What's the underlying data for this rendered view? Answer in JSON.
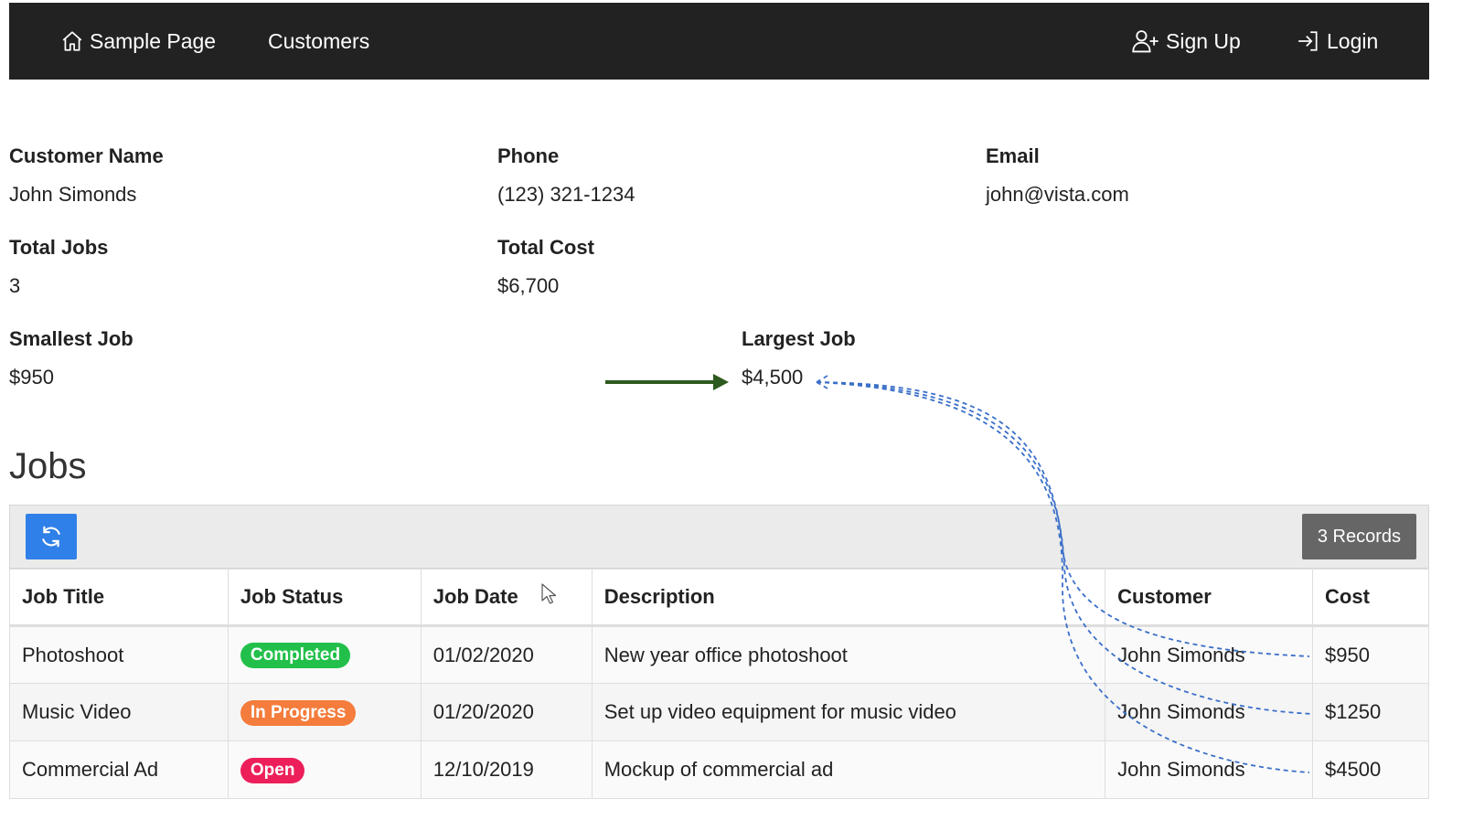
{
  "nav": {
    "brand_label": "Sample Page",
    "customers_label": "Customers",
    "signup_label": "Sign Up",
    "login_label": "Login",
    "brand_icon": "home-icon",
    "signup_icon": "user-plus-icon",
    "login_icon": "login-icon"
  },
  "customer": {
    "name_label": "Customer Name",
    "name": "John Simonds",
    "phone_label": "Phone",
    "phone": "(123) 321-1234",
    "email_label": "Email",
    "email": "john@vista.com",
    "total_jobs_label": "Total Jobs",
    "total_jobs": "3",
    "total_cost_label": "Total Cost",
    "total_cost": "$6,700",
    "smallest_job_label": "Smallest Job",
    "smallest_job": "$950",
    "largest_job_label": "Largest Job",
    "largest_job": "$4,500"
  },
  "jobs": {
    "heading": "Jobs",
    "refresh_icon": "refresh-icon",
    "records_label": "3 Records",
    "columns": [
      "Job Title",
      "Job Status",
      "Job Date",
      "Description",
      "Customer",
      "Cost"
    ],
    "rows": [
      {
        "title": "Photoshoot",
        "status": "Completed",
        "date": "01/02/2020",
        "description": "New year office photoshoot",
        "customer": "John Simonds",
        "cost": "$950"
      },
      {
        "title": "Music Video",
        "status": "In Progress",
        "date": "01/20/2020",
        "description": "Set up video equipment for music video",
        "customer": "John Simonds",
        "cost": "$1250"
      },
      {
        "title": "Commercial Ad",
        "status": "Open",
        "date": "12/10/2019",
        "description": "Mockup of commercial ad",
        "customer": "John Simonds",
        "cost": "$4500"
      }
    ]
  },
  "colors": {
    "navbar": "#222222",
    "refresh_button": "#2f80e8",
    "records_button": "#666666",
    "status_completed": "#22c04a",
    "status_in_progress": "#f47c3c",
    "status_open": "#ec1f5a",
    "annotation_arrow": "#2d5a1e",
    "annotation_dashed": "#3a6fc9"
  }
}
